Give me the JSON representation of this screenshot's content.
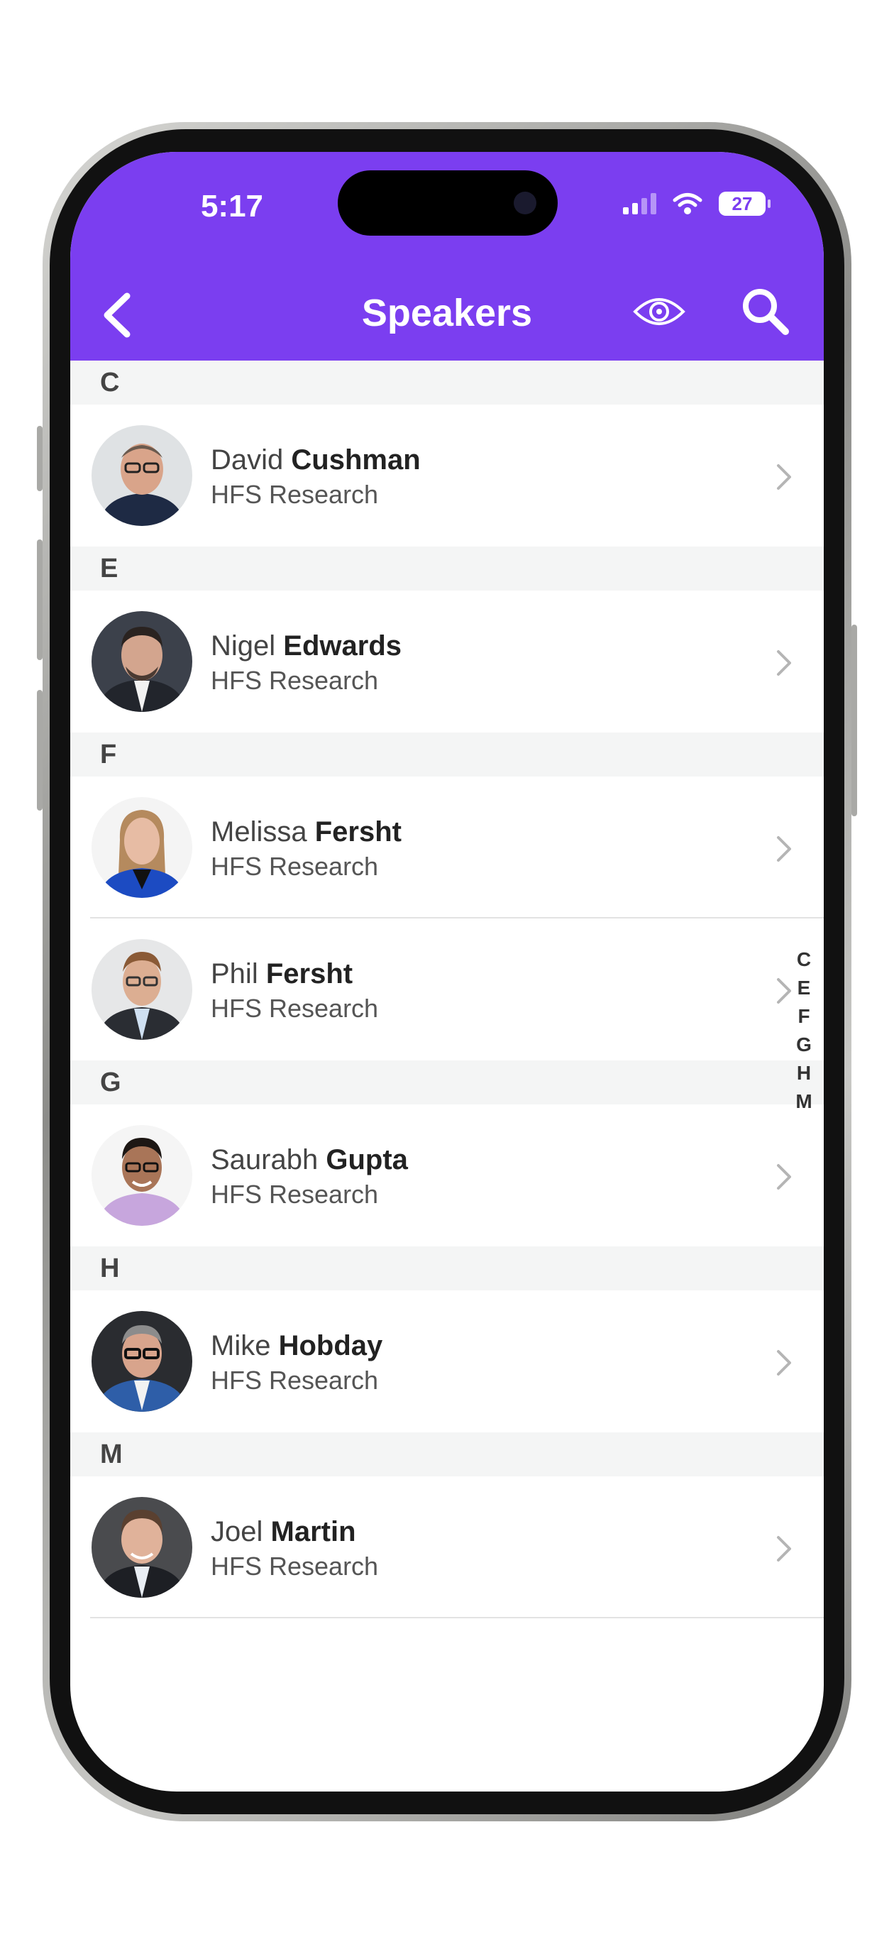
{
  "status_bar": {
    "time": "5:17",
    "battery": "27"
  },
  "nav": {
    "title": "Speakers"
  },
  "index_letters": [
    "C",
    "E",
    "F",
    "G",
    "H",
    "M"
  ],
  "sections": [
    {
      "letter": "C",
      "speakers": [
        {
          "first": "David",
          "last": "Cushman",
          "company": "HFS Research"
        }
      ]
    },
    {
      "letter": "E",
      "speakers": [
        {
          "first": "Nigel",
          "last": "Edwards",
          "company": "HFS Research"
        }
      ]
    },
    {
      "letter": "F",
      "speakers": [
        {
          "first": "Melissa",
          "last": "Fersht",
          "company": "HFS Research"
        },
        {
          "first": "Phil",
          "last": "Fersht",
          "company": "HFS Research"
        }
      ]
    },
    {
      "letter": "G",
      "speakers": [
        {
          "first": "Saurabh",
          "last": "Gupta",
          "company": "HFS Research"
        }
      ]
    },
    {
      "letter": "H",
      "speakers": [
        {
          "first": "Mike",
          "last": "Hobday",
          "company": "HFS Research"
        }
      ]
    },
    {
      "letter": "M",
      "speakers": [
        {
          "first": "Joel",
          "last": "Martin",
          "company": "HFS Research"
        }
      ]
    }
  ],
  "colors": {
    "header": "#7b3ef0",
    "section_bg": "#f4f5f5"
  },
  "icons": {
    "back": "chevron-left-icon",
    "eye": "eye-icon",
    "search": "search-icon",
    "row": "chevron-right-icon"
  }
}
